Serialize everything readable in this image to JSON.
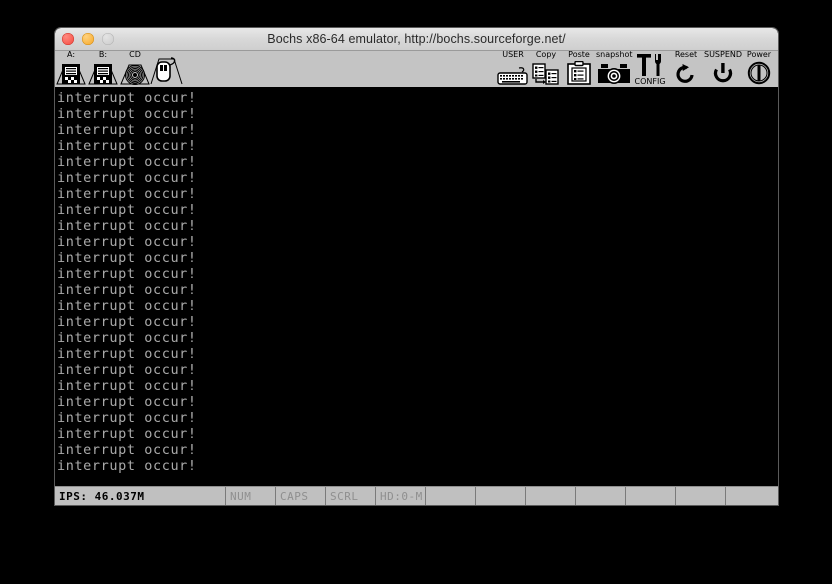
{
  "window": {
    "title": "Bochs x86-64 emulator, http://bochs.sourceforge.net/",
    "controls": [
      {
        "name": "close-button",
        "label": "close"
      },
      {
        "name": "minimize-button",
        "label": "minimize"
      },
      {
        "name": "zoom-button",
        "label": "zoom"
      }
    ]
  },
  "toolbar": {
    "left_items": [
      {
        "icon": "floppy-a-icon",
        "label": "A:"
      },
      {
        "icon": "floppy-b-icon",
        "label": "B:"
      },
      {
        "icon": "cdrom-icon",
        "label": "CD"
      },
      {
        "icon": "mouse-icon",
        "label": ""
      }
    ],
    "right_items": [
      {
        "icon": "keyboard-icon",
        "label": "USER"
      },
      {
        "icon": "copy-icon",
        "label": "Copy"
      },
      {
        "icon": "paste-icon",
        "label": "Poste"
      },
      {
        "icon": "camera-icon",
        "label": "snapshot"
      },
      {
        "icon": "wrench-icon",
        "label": "CONFIG"
      },
      {
        "icon": "reset-icon",
        "label": "Reset"
      },
      {
        "icon": "suspend-icon",
        "label": "SUSPEND"
      },
      {
        "icon": "power-icon",
        "label": "Power"
      }
    ]
  },
  "terminal": {
    "line_text": "interrupt occur!",
    "lines": [
      "interrupt occur!",
      "interrupt occur!",
      "interrupt occur!",
      "interrupt occur!",
      "interrupt occur!",
      "interrupt occur!",
      "interrupt occur!",
      "interrupt occur!",
      "interrupt occur!",
      "interrupt occur!",
      "interrupt occur!",
      "interrupt occur!",
      "interrupt occur!",
      "interrupt occur!",
      "interrupt occur!",
      "interrupt occur!",
      "interrupt occur!",
      "interrupt occur!",
      "interrupt occur!",
      "interrupt occur!",
      "interrupt occur!",
      "interrupt occur!",
      "interrupt occur!",
      "interrupt occur!"
    ],
    "foreground_color": "#aaaaaa",
    "background_color": "#000000"
  },
  "statusbar": {
    "ips": "IPS: 46.037M",
    "num": "NUM",
    "caps": "CAPS",
    "scrl": "SCRL",
    "hd": "HD:0-M",
    "empty": [
      "",
      "",
      "",
      "",
      "",
      "",
      ""
    ]
  },
  "colors": {
    "toolbar_bg": "#c4c4c4",
    "statusbar_bg": "#c0c0c0",
    "titlebar_bg": "#d8d8d8",
    "desktop_bg": "#000000",
    "indicator_off": "#8f8f8f"
  }
}
